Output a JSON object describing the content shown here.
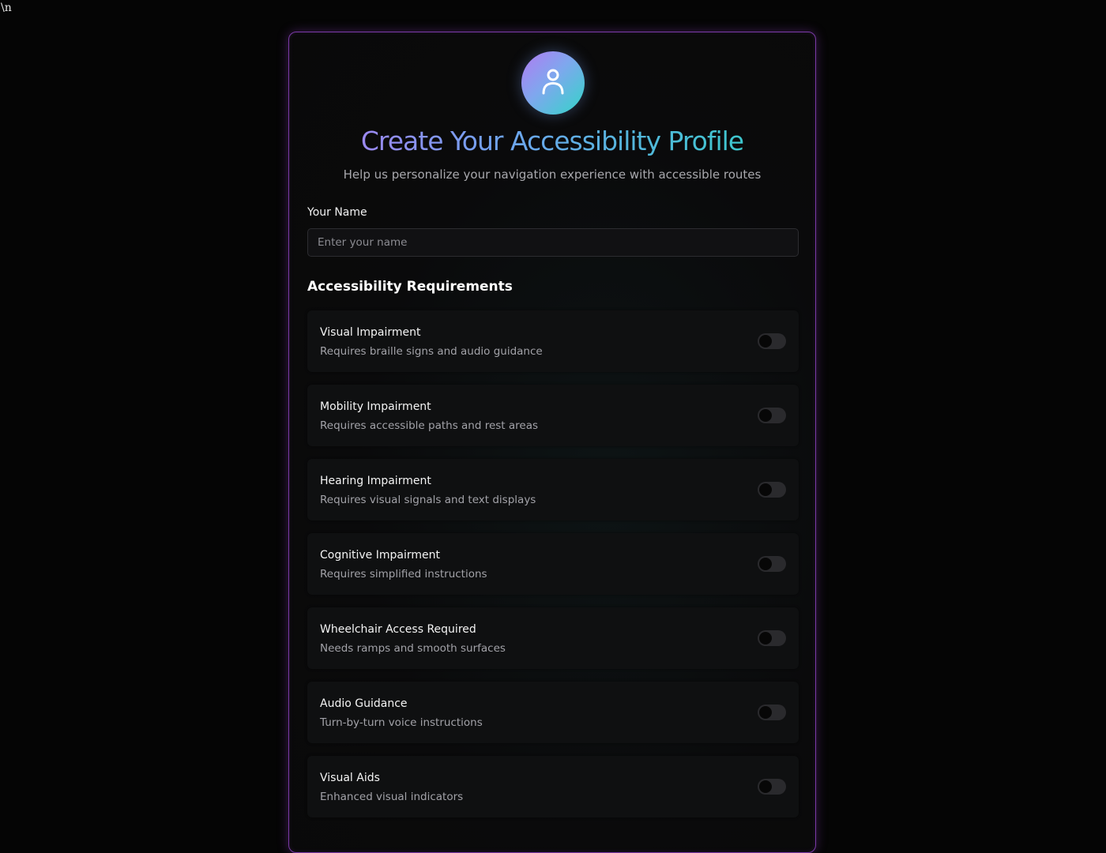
{
  "stray_text": "\\n",
  "header": {
    "avatar_icon": "user-icon",
    "title": "Create Your Accessibility Profile",
    "subtitle": "Help us personalize your navigation experience with accessible routes"
  },
  "name_field": {
    "label": "Your Name",
    "placeholder": "Enter your name",
    "value": ""
  },
  "requirements": {
    "section_title": "Accessibility Requirements",
    "options": [
      {
        "title": "Visual Impairment",
        "description": "Requires braille signs and audio guidance",
        "enabled": false
      },
      {
        "title": "Mobility Impairment",
        "description": "Requires accessible paths and rest areas",
        "enabled": false
      },
      {
        "title": "Hearing Impairment",
        "description": "Requires visual signals and text displays",
        "enabled": false
      },
      {
        "title": "Cognitive Impairment",
        "description": "Requires simplified instructions",
        "enabled": false
      },
      {
        "title": "Wheelchair Access Required",
        "description": "Needs ramps and smooth surfaces",
        "enabled": false
      },
      {
        "title": "Audio Guidance",
        "description": "Turn-by-turn voice instructions",
        "enabled": false
      },
      {
        "title": "Visual Aids",
        "description": "Enhanced visual indicators",
        "enabled": false
      }
    ]
  },
  "colors": {
    "background": "#050505",
    "card_border": "#7b3aa8",
    "gradient_start": "#b27af2",
    "gradient_end": "#2fd1c4",
    "toggle_off": "#2a2a2d"
  }
}
